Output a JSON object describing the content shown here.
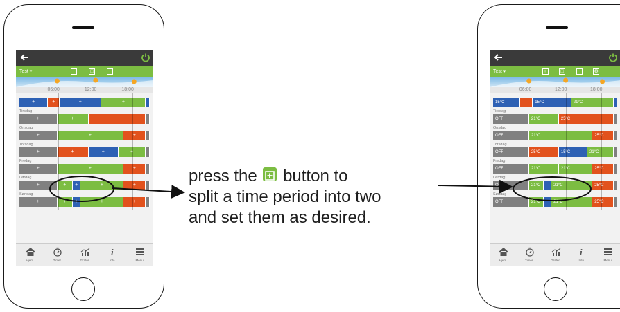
{
  "colors": {
    "gray": "#808080",
    "green": "#7cbd42",
    "red": "#e2521d",
    "blue": "#2e61b4",
    "dark": "#3a3a3a"
  },
  "screen_common": {
    "program_name": "Test ▾",
    "time_ticks": [
      "06:00",
      "12:00",
      "18:00"
    ],
    "icons": {
      "back": "back-arrow-icon",
      "power": "power-icon"
    },
    "green_buttons": [
      "plus-box-icon",
      "copy-box-icon",
      "minus-box-icon"
    ],
    "tabs": [
      {
        "label": "Hjem",
        "icon": "home-icon"
      },
      {
        "label": "Timer",
        "icon": "timer-icon"
      },
      {
        "label": "Grafer",
        "icon": "chart-icon"
      },
      {
        "label": "Info",
        "icon": "info-icon"
      },
      {
        "label": "Menu",
        "icon": "menu-icon"
      }
    ]
  },
  "right_extra_button": "settings-box-icon",
  "left_screen": {
    "days": [
      {
        "name": "",
        "segments": [
          [
            "blue",
            0,
            22,
            "+"
          ],
          [
            "red",
            22,
            31,
            "+"
          ],
          [
            "blue",
            31,
            63,
            "+"
          ],
          [
            "green",
            63,
            97,
            "+"
          ],
          [
            "blue",
            97,
            100,
            ""
          ]
        ]
      },
      {
        "name": "Tirsdag",
        "segments": [
          [
            "gray",
            0,
            29,
            "+"
          ],
          [
            "green",
            29,
            53,
            "+"
          ],
          [
            "red",
            53,
            97,
            "+"
          ],
          [
            "gray",
            97,
            100,
            ""
          ]
        ]
      },
      {
        "name": "Onsdag",
        "segments": [
          [
            "gray",
            0,
            29,
            "+"
          ],
          [
            "green",
            29,
            80,
            "+"
          ],
          [
            "red",
            80,
            97,
            "+"
          ],
          [
            "gray",
            97,
            100,
            ""
          ]
        ]
      },
      {
        "name": "Torsdag",
        "segments": [
          [
            "gray",
            0,
            29,
            "+"
          ],
          [
            "red",
            29,
            53,
            "+"
          ],
          [
            "blue",
            53,
            76,
            "+"
          ],
          [
            "green",
            76,
            97,
            "+"
          ],
          [
            "gray",
            97,
            100,
            ""
          ]
        ]
      },
      {
        "name": "Fredag",
        "segments": [
          [
            "gray",
            0,
            29,
            "+"
          ],
          [
            "green",
            29,
            80,
            "+"
          ],
          [
            "red",
            80,
            97,
            "+"
          ],
          [
            "gray",
            97,
            100,
            ""
          ]
        ]
      },
      {
        "name": "Lørdag",
        "segments": [
          [
            "gray",
            0,
            29,
            "+"
          ],
          [
            "green",
            29,
            41,
            "+"
          ],
          [
            "blue",
            41,
            47,
            "+"
          ],
          [
            "green",
            47,
            80,
            "+"
          ],
          [
            "red",
            80,
            97,
            "+"
          ],
          [
            "gray",
            97,
            100,
            ""
          ]
        ]
      },
      {
        "name": "Søndag",
        "segments": [
          [
            "gray",
            0,
            29,
            "+"
          ],
          [
            "green",
            29,
            41,
            "+"
          ],
          [
            "blue",
            41,
            47,
            "+"
          ],
          [
            "green",
            47,
            80,
            "+"
          ],
          [
            "red",
            80,
            97,
            "+"
          ],
          [
            "gray",
            97,
            100,
            ""
          ]
        ]
      }
    ]
  },
  "right_screen": {
    "days": [
      {
        "name": "",
        "segments": [
          [
            "blue",
            0,
            22,
            "15°C"
          ],
          [
            "red",
            22,
            32,
            ""
          ],
          [
            "blue",
            32,
            63,
            "15°C"
          ],
          [
            "green",
            63,
            97,
            "21°C"
          ],
          [
            "blue",
            97,
            100,
            ""
          ]
        ]
      },
      {
        "name": "Tirsdag",
        "segments": [
          [
            "gray",
            0,
            29,
            "OFF"
          ],
          [
            "green",
            29,
            53,
            "21°C"
          ],
          [
            "red",
            53,
            97,
            "25°C"
          ],
          [
            "gray",
            97,
            100,
            ""
          ]
        ]
      },
      {
        "name": "Onsdag",
        "segments": [
          [
            "gray",
            0,
            29,
            "OFF"
          ],
          [
            "green",
            29,
            80,
            "21°C"
          ],
          [
            "red",
            80,
            97,
            "25°C"
          ],
          [
            "gray",
            97,
            100,
            ""
          ]
        ]
      },
      {
        "name": "Torsdag",
        "segments": [
          [
            "gray",
            0,
            29,
            "OFF"
          ],
          [
            "red",
            29,
            53,
            "25°C"
          ],
          [
            "blue",
            53,
            76,
            "15°C"
          ],
          [
            "green",
            76,
            97,
            "21°C"
          ],
          [
            "gray",
            97,
            100,
            ""
          ]
        ]
      },
      {
        "name": "Fredag",
        "segments": [
          [
            "gray",
            0,
            29,
            "OFF"
          ],
          [
            "green",
            29,
            53,
            "21°C"
          ],
          [
            "green",
            53,
            80,
            "21°C"
          ],
          [
            "red",
            80,
            97,
            "25°C"
          ],
          [
            "gray",
            97,
            100,
            ""
          ]
        ]
      },
      {
        "name": "Lørdag",
        "segments": [
          [
            "gray",
            0,
            29,
            "OFF"
          ],
          [
            "green",
            29,
            41,
            "21°C"
          ],
          [
            "blue",
            41,
            47,
            ""
          ],
          [
            "green",
            47,
            80,
            "21°C"
          ],
          [
            "red",
            80,
            97,
            "25°C"
          ],
          [
            "gray",
            97,
            100,
            ""
          ]
        ]
      },
      {
        "name": "Søndag",
        "segments": [
          [
            "gray",
            0,
            29,
            "OFF"
          ],
          [
            "green",
            29,
            41,
            "21°C"
          ],
          [
            "blue",
            41,
            47,
            ""
          ],
          [
            "green",
            47,
            80,
            "21°C"
          ],
          [
            "red",
            80,
            97,
            "25°C"
          ],
          [
            "gray",
            97,
            100,
            ""
          ]
        ]
      }
    ]
  },
  "callout": {
    "line1_pre": "press the",
    "line1_icon": "plus-box-icon",
    "line1_post": "button to",
    "line2": "split a time period into two",
    "line3": "and set them as desired."
  }
}
